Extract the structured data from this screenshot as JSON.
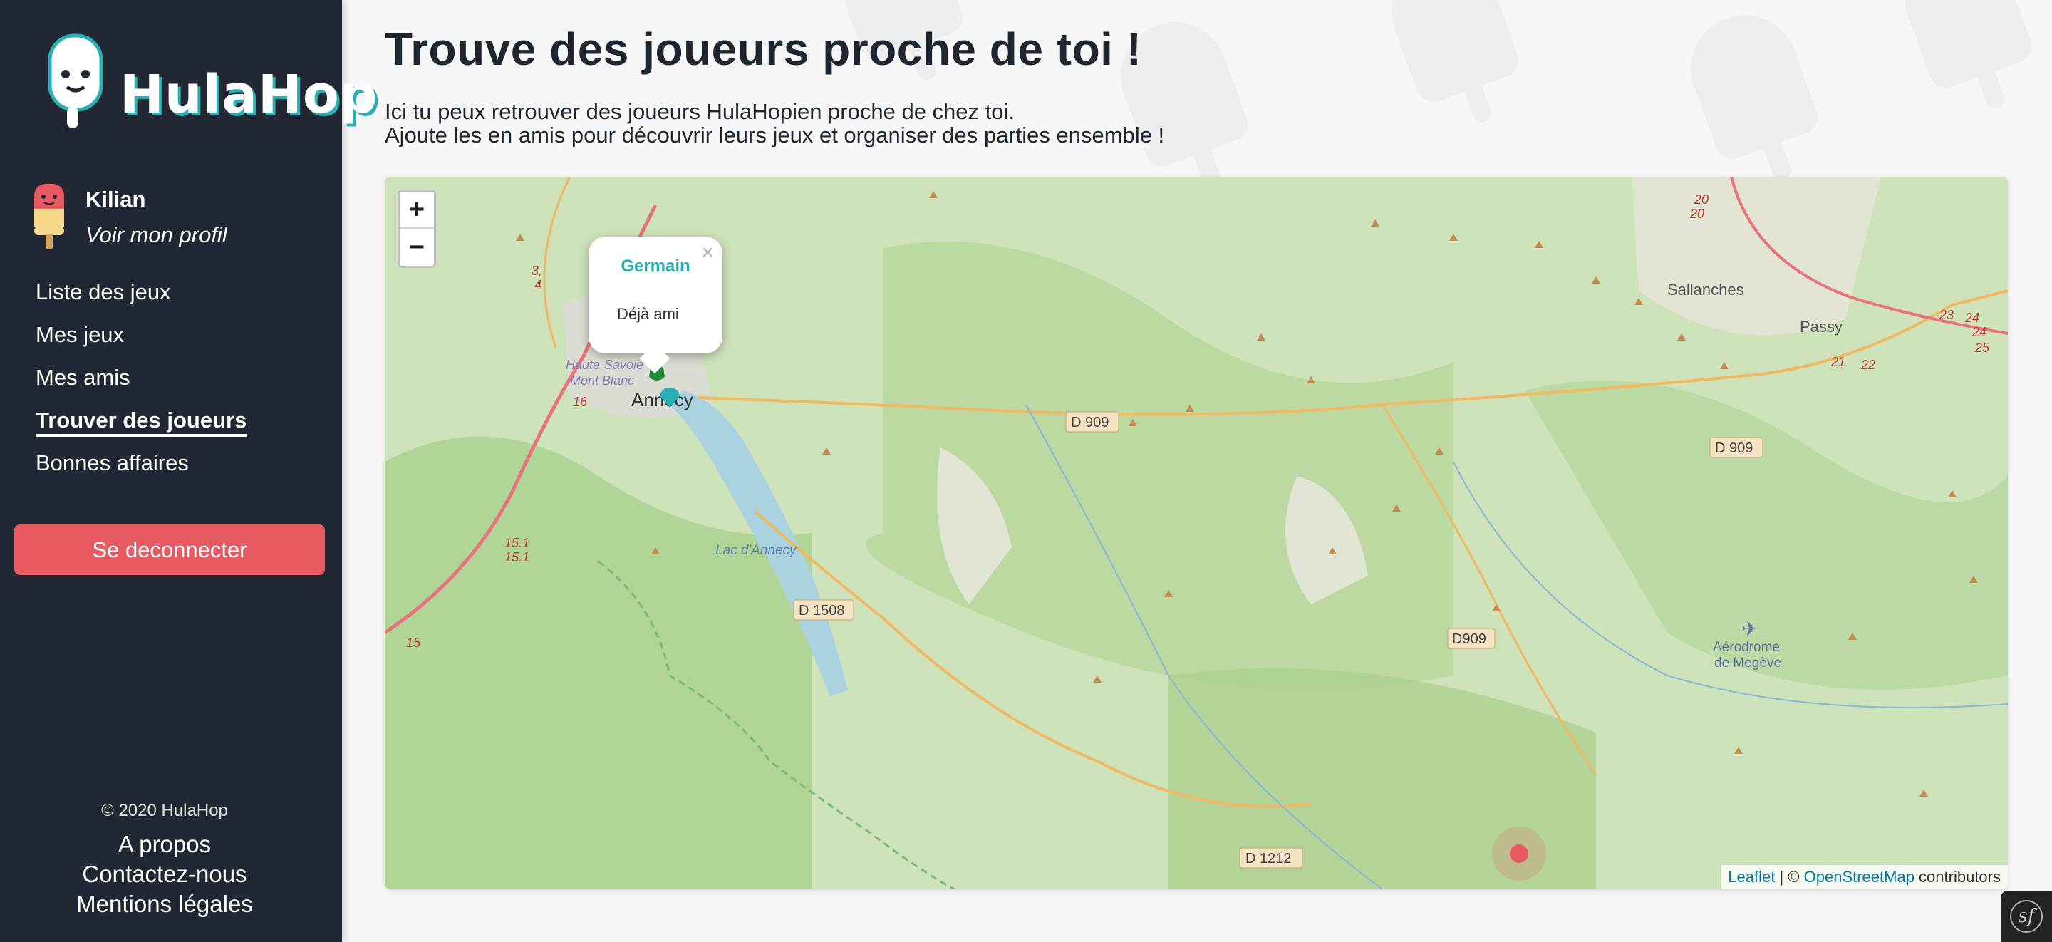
{
  "brand": {
    "logo_text": "HulaHop"
  },
  "user": {
    "name": "Kilian",
    "profile_link": "Voir mon profil"
  },
  "nav": {
    "items": [
      {
        "label": "Liste des jeux",
        "active": false
      },
      {
        "label": "Mes jeux",
        "active": false
      },
      {
        "label": "Mes amis",
        "active": false
      },
      {
        "label": "Trouver des joueurs",
        "active": true
      },
      {
        "label": "Bonnes affaires",
        "active": false
      }
    ],
    "logout_label": "Se deconnecter"
  },
  "footer": {
    "copyright": "© 2020 HulaHop",
    "links": [
      "A propos",
      "Contactez-nous",
      "Mentions légales"
    ]
  },
  "page": {
    "title": "Trouve des joueurs proche de toi !",
    "description_line1": "Ici tu peux retrouver des joueurs HulaHopien proche de chez toi.",
    "description_line2": "Ajoute les en amis pour découvrir leurs jeux et organiser des parties ensemble !"
  },
  "map": {
    "zoom_in": "+",
    "zoom_out": "−",
    "popup": {
      "name": "Germain",
      "status": "Déjà ami",
      "close": "×"
    },
    "labels": {
      "city_annecy": "Annecy",
      "lake": "Lac d'Annecy",
      "sallanches": "Sallanches",
      "passy": "Passy",
      "aerodrome_line1": "Aérodrome",
      "aerodrome_line2": "de Megève",
      "haute_savoie": "Haute-Savoie",
      "mont_blanc": "Mont Blanc"
    },
    "roads": [
      "D 909",
      "D 909",
      "D 1508",
      "D909",
      "D 1212"
    ],
    "route_numbers": [
      "3,",
      "4",
      "16",
      "15.1",
      "15.1",
      "15",
      "20",
      "20",
      "23",
      "24",
      "24",
      "25",
      "21",
      "22"
    ],
    "attribution": {
      "leaflet": "Leaflet",
      "separator": " | © ",
      "osm": "OpenStreetMap",
      "suffix": " contributors"
    },
    "markers": [
      {
        "type": "friend",
        "color": "#1e8a3c"
      },
      {
        "type": "me",
        "color": "#29b0b4"
      },
      {
        "type": "player",
        "color": "#e85a62"
      }
    ]
  },
  "colors": {
    "sidebar": "#222833",
    "accent": "#29b0b4",
    "logout": "#e85a62"
  },
  "symfony_badge": "sf"
}
